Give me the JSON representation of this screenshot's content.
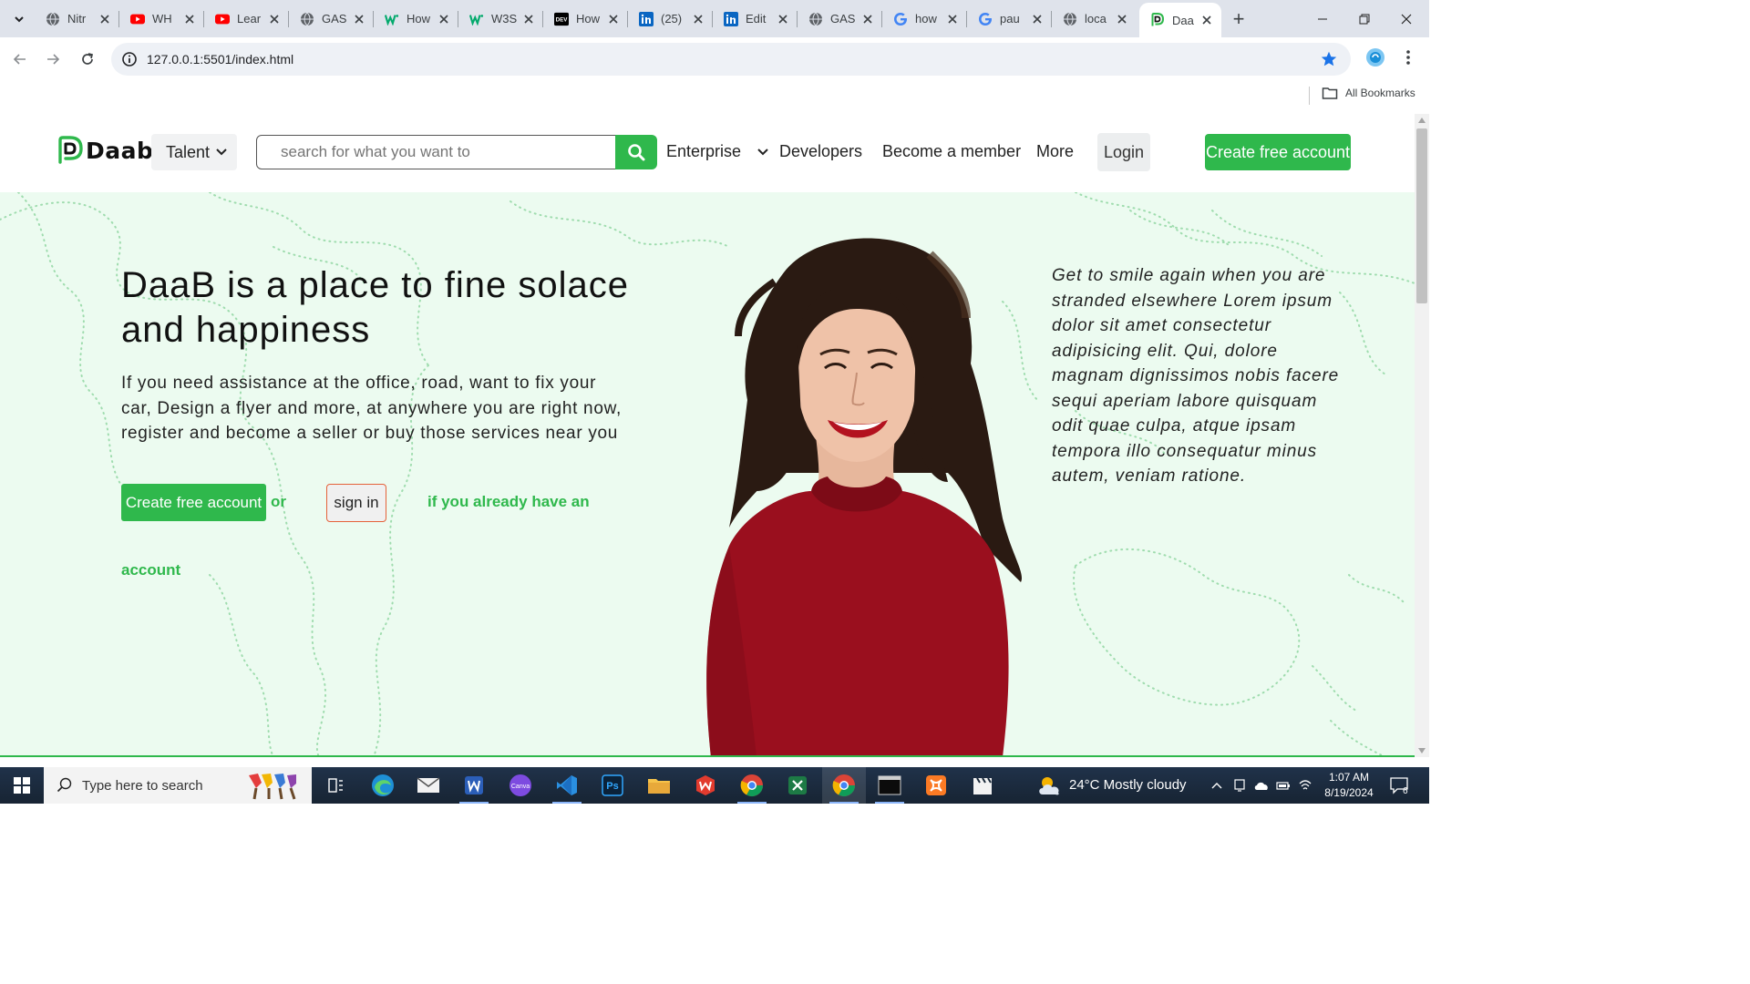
{
  "browser": {
    "tabs": [
      {
        "label": "Nitr",
        "icon": "globe-icon"
      },
      {
        "label": "WH",
        "icon": "youtube-icon"
      },
      {
        "label": "Lear",
        "icon": "youtube-icon"
      },
      {
        "label": "GAS",
        "icon": "globe-icon"
      },
      {
        "label": "How",
        "icon": "w3-icon"
      },
      {
        "label": "W3S",
        "icon": "w3-icon"
      },
      {
        "label": "How",
        "icon": "dev-icon"
      },
      {
        "label": "(25)",
        "icon": "linkedin-icon"
      },
      {
        "label": "Edit",
        "icon": "linkedin-icon"
      },
      {
        "label": "GAS",
        "icon": "globe-icon"
      },
      {
        "label": "how",
        "icon": "google-icon"
      },
      {
        "label": "pau",
        "icon": "google-icon"
      },
      {
        "label": "loca",
        "icon": "globe-icon"
      },
      {
        "label": "Daa",
        "icon": "daab-icon",
        "active": true
      }
    ],
    "dev_badge": "DEV",
    "url": "127.0.0.1:5501/index.html",
    "bookmarks_label": "All Bookmarks"
  },
  "site": {
    "brand": "Daab",
    "nav": {
      "talent": "Talent",
      "search_placeholder": "search for what you want to",
      "enterprise": "Enterprise",
      "developers": "Developers",
      "member": "Become a member",
      "more": "More",
      "login": "Login",
      "cta": "Create free account"
    },
    "hero": {
      "headline": "DaaB is a place to fine solace and happiness",
      "lead": "If you need assistance at the office, road, want to fix your car, Design a flyer and more, at anywhere you are right now, register and become a seller or buy those services near you",
      "create_button": "Create free account",
      "or": "or",
      "signin_button": "sign in",
      "already_1": "if you already have an",
      "already_2": "account",
      "quote": "Get to smile again when you are stranded elsewhere Lorem ipsum dolor sit amet consectetur adipisicing elit. Qui, dolore magnam dignissimos nobis facere sequi aperiam labore quisquam odit quae culpa, atque ipsam tempora illo consequatur minus autem, veniam ratione."
    },
    "colors": {
      "accent": "#2fb84c",
      "hero_bg": "#ecfbf0",
      "signin_border": "#e5623a"
    }
  },
  "taskbar": {
    "search_placeholder": "Type here to search",
    "apps": [
      "paint-brushes-icon",
      "task-view-icon",
      "edge-icon",
      "mail-icon",
      "word-icon",
      "canva-icon",
      "vscode-icon",
      "photoshop-icon",
      "file-explorer-icon",
      "wps-icon",
      "chrome-icon",
      "excel-icon",
      "chrome-active-icon",
      "terminal-icon",
      "xampp-icon",
      "clapper-icon"
    ],
    "canva_label": "Canva",
    "ps_label": "Ps",
    "weather": "24°C  Mostly cloudy",
    "time": "1:07 AM",
    "date": "8/19/2024",
    "notifications": "6"
  }
}
